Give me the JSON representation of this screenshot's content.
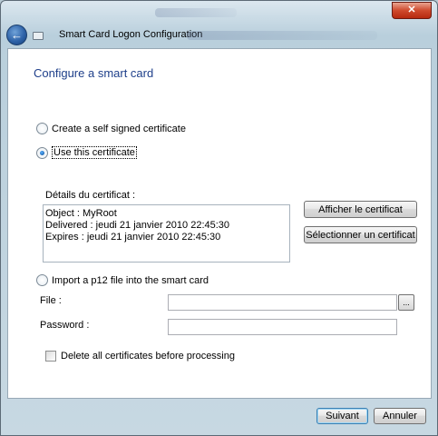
{
  "window": {
    "title": "Smart Card Logon Configuration",
    "close_glyph": "✕",
    "back_glyph": "←"
  },
  "heading": "Configure a smart card",
  "options": {
    "self_signed": "Create a self signed certificate",
    "use_cert": "Use this certificate",
    "import_p12": "Import a p12 file into the smart card"
  },
  "details": {
    "label": "Détails du certificat :",
    "lines": [
      "Object : MyRoot",
      "Delivered : jeudi 21 janvier 2010 22:45:30",
      "Expires : jeudi 21 janvier 2010 22:45:30"
    ],
    "show_button": "Afficher le certificat",
    "select_button": "Sélectionner un certificat"
  },
  "import": {
    "file_label": "File :",
    "file_value": "",
    "browse_label": "...",
    "password_label": "Password :",
    "password_value": ""
  },
  "delete_all_label": "Delete all certificates before processing",
  "footer": {
    "next_label": "Suivant",
    "cancel_label": "Annuler"
  },
  "colors": {
    "heading": "#1e3f8a",
    "close_button": "#c7432a",
    "window_frame": "#b9cfdc"
  },
  "icons": [
    "back-arrow-icon",
    "window-app-icon",
    "close-icon"
  ]
}
